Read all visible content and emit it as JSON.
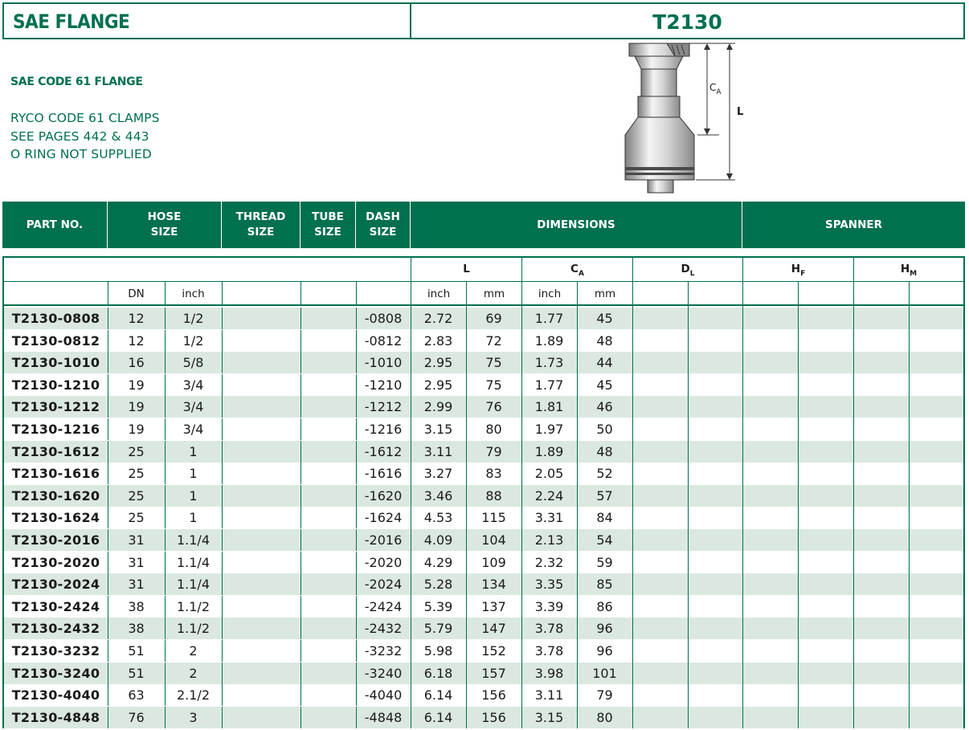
{
  "header": {
    "section_title": "SAE FLANGE",
    "part_series": "T2130"
  },
  "info": {
    "subtitle": "SAE CODE 61 FLANGE",
    "notes": [
      "RYCO CODE 61 CLAMPS",
      "SEE PAGES 442 & 443",
      "O RING NOT SUPPLIED"
    ]
  },
  "diagram": {
    "label_ca": "C",
    "label_ca_sub": "A",
    "label_l": "L"
  },
  "table": {
    "group_headers": {
      "part_no": "PART NO.",
      "hose_size": [
        "HOSE",
        "SIZE"
      ],
      "thread_size": [
        "THREAD",
        "SIZE"
      ],
      "tube_size": [
        "TUBE",
        "SIZE"
      ],
      "dash_size": [
        "DASH",
        "SIZE"
      ],
      "dimensions": "DIMENSIONS",
      "spanner": "SPANNER"
    },
    "dim_headers": {
      "l": "L",
      "ca": "C",
      "ca_sub": "A",
      "dl": "D",
      "dl_sub": "L",
      "hf": "H",
      "hf_sub": "F",
      "hm": "H",
      "hm_sub": "M"
    },
    "sub_headers": {
      "dn": "DN",
      "inch": "inch",
      "l_inch": "inch",
      "l_mm": "mm",
      "ca_inch": "inch",
      "ca_mm": "mm"
    },
    "rows": [
      {
        "part": "T2130-0808",
        "dn": "12",
        "inch": "1/2",
        "dash": "-0808",
        "l_in": "2.72",
        "l_mm": "69",
        "ca_in": "1.77",
        "ca_mm": "45"
      },
      {
        "part": "T2130-0812",
        "dn": "12",
        "inch": "1/2",
        "dash": "-0812",
        "l_in": "2.83",
        "l_mm": "72",
        "ca_in": "1.89",
        "ca_mm": "48"
      },
      {
        "part": "T2130-1010",
        "dn": "16",
        "inch": "5/8",
        "dash": "-1010",
        "l_in": "2.95",
        "l_mm": "75",
        "ca_in": "1.73",
        "ca_mm": "44"
      },
      {
        "part": "T2130-1210",
        "dn": "19",
        "inch": "3/4",
        "dash": "-1210",
        "l_in": "2.95",
        "l_mm": "75",
        "ca_in": "1.77",
        "ca_mm": "45"
      },
      {
        "part": "T2130-1212",
        "dn": "19",
        "inch": "3/4",
        "dash": "-1212",
        "l_in": "2.99",
        "l_mm": "76",
        "ca_in": "1.81",
        "ca_mm": "46"
      },
      {
        "part": "T2130-1216",
        "dn": "19",
        "inch": "3/4",
        "dash": "-1216",
        "l_in": "3.15",
        "l_mm": "80",
        "ca_in": "1.97",
        "ca_mm": "50"
      },
      {
        "part": "T2130-1612",
        "dn": "25",
        "inch": "1",
        "dash": "-1612",
        "l_in": "3.11",
        "l_mm": "79",
        "ca_in": "1.89",
        "ca_mm": "48"
      },
      {
        "part": "T2130-1616",
        "dn": "25",
        "inch": "1",
        "dash": "-1616",
        "l_in": "3.27",
        "l_mm": "83",
        "ca_in": "2.05",
        "ca_mm": "52"
      },
      {
        "part": "T2130-1620",
        "dn": "25",
        "inch": "1",
        "dash": "-1620",
        "l_in": "3.46",
        "l_mm": "88",
        "ca_in": "2.24",
        "ca_mm": "57"
      },
      {
        "part": "T2130-1624",
        "dn": "25",
        "inch": "1",
        "dash": "-1624",
        "l_in": "4.53",
        "l_mm": "115",
        "ca_in": "3.31",
        "ca_mm": "84"
      },
      {
        "part": "T2130-2016",
        "dn": "31",
        "inch": "1.1/4",
        "dash": "-2016",
        "l_in": "4.09",
        "l_mm": "104",
        "ca_in": "2.13",
        "ca_mm": "54"
      },
      {
        "part": "T2130-2020",
        "dn": "31",
        "inch": "1.1/4",
        "dash": "-2020",
        "l_in": "4.29",
        "l_mm": "109",
        "ca_in": "2.32",
        "ca_mm": "59"
      },
      {
        "part": "T2130-2024",
        "dn": "31",
        "inch": "1.1/4",
        "dash": "-2024",
        "l_in": "5.28",
        "l_mm": "134",
        "ca_in": "3.35",
        "ca_mm": "85"
      },
      {
        "part": "T2130-2424",
        "dn": "38",
        "inch": "1.1/2",
        "dash": "-2424",
        "l_in": "5.39",
        "l_mm": "137",
        "ca_in": "3.39",
        "ca_mm": "86"
      },
      {
        "part": "T2130-2432",
        "dn": "38",
        "inch": "1.1/2",
        "dash": "-2432",
        "l_in": "5.79",
        "l_mm": "147",
        "ca_in": "3.78",
        "ca_mm": "96"
      },
      {
        "part": "T2130-3232",
        "dn": "51",
        "inch": "2",
        "dash": "-3232",
        "l_in": "5.98",
        "l_mm": "152",
        "ca_in": "3.78",
        "ca_mm": "96"
      },
      {
        "part": "T2130-3240",
        "dn": "51",
        "inch": "2",
        "dash": "-3240",
        "l_in": "6.18",
        "l_mm": "157",
        "ca_in": "3.98",
        "ca_mm": "101"
      },
      {
        "part": "T2130-4040",
        "dn": "63",
        "inch": "2.1/2",
        "dash": "-4040",
        "l_in": "6.14",
        "l_mm": "156",
        "ca_in": "3.11",
        "ca_mm": "79"
      },
      {
        "part": "T2130-4848",
        "dn": "76",
        "inch": "3",
        "dash": "-4848",
        "l_in": "6.14",
        "l_mm": "156",
        "ca_in": "3.15",
        "ca_mm": "80"
      }
    ]
  },
  "colors": {
    "brand_green": "#00704f",
    "row_alt": "#dbe8e0"
  }
}
